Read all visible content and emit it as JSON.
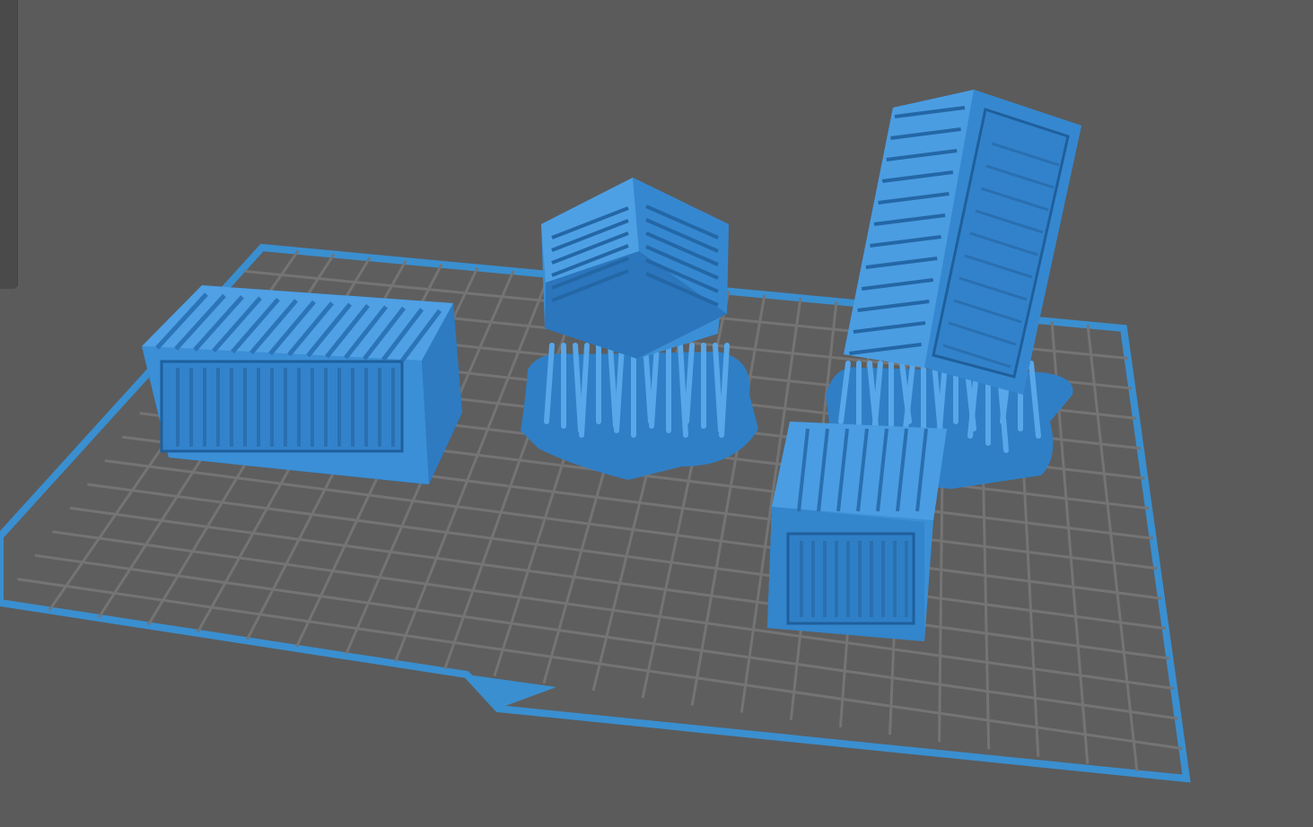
{
  "app": {
    "view": "3d-slicer-viewport"
  },
  "colors": {
    "background": "#5b5b5b",
    "plate_fill": "#5e5e5e",
    "plate_border": "#3a8fd0",
    "grid": "#747474",
    "model_main": "#3b8fd6",
    "model_light": "#5cabec",
    "model_dark": "#2469a8",
    "model_shadow": "#1d5a94"
  },
  "scene": {
    "build_plate": {
      "grid": true
    },
    "models": [
      {
        "name": "crate-long-horizontal"
      },
      {
        "name": "crate-cube-on-supports"
      },
      {
        "name": "crate-tall-tilted-on-supports"
      },
      {
        "name": "crate-small-front"
      }
    ]
  }
}
